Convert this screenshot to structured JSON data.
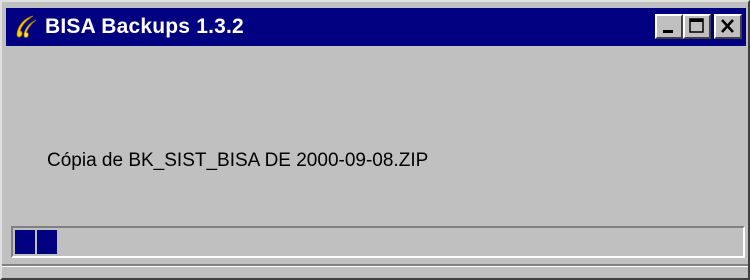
{
  "window": {
    "title": "BISA Backups 1.3.2",
    "icon": "bisa-logo-icon",
    "controls": {
      "minimize": "minimize-icon",
      "maximize": "maximize-icon",
      "close": "close-icon"
    }
  },
  "status": {
    "message": "Cópia de BK_SIST_BISA DE 2000-09-08.ZIP"
  },
  "progress": {
    "fraction": 0.06,
    "color": "#000080"
  },
  "colors": {
    "titlebar": "#000080",
    "face": "#c0c0c0"
  }
}
